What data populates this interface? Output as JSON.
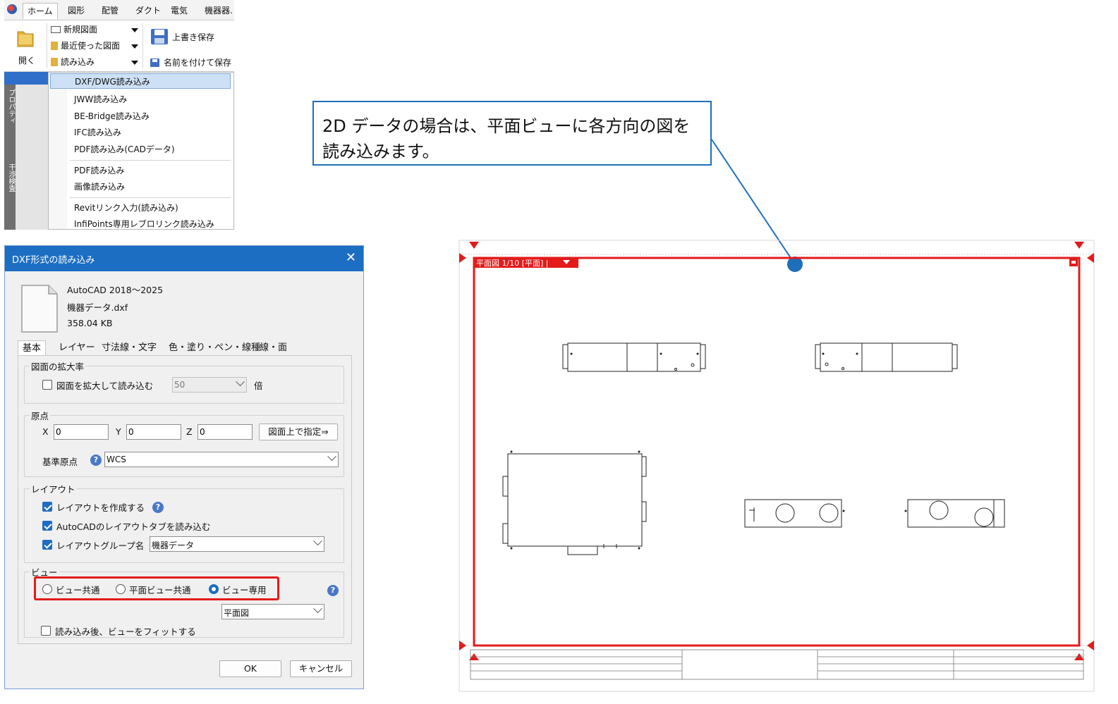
{
  "ribbon": {
    "tabs": [
      "ホーム",
      "図形",
      "配管",
      "ダクト",
      "電気",
      "機器器."
    ],
    "open_label": "開く",
    "menu": {
      "new_drawing": "新規図面",
      "recent": "最近使った図面",
      "import": "読み込み"
    },
    "save": "上書き保存",
    "save_as": "名前を付けて保存",
    "side_tabs": [
      "プロパティ",
      "干渉検査"
    ]
  },
  "dropdown": {
    "items": [
      "DXF/DWG読み込み",
      "JWW読み込み",
      "BE-Bridge読み込み",
      "IFC読み込み",
      "PDF読み込み(CADデータ)",
      "PDF読み込み",
      "画像読み込み",
      "Revitリンク入力(読み込み)",
      "InfiPoints専用レブロリンク読み込み"
    ]
  },
  "dialog": {
    "title": "DXF形式の読み込み",
    "file": {
      "version": "AutoCAD 2018～2025",
      "name": "機器データ.dxf",
      "size": "358.04 KB"
    },
    "tabs": [
      "基本",
      "レイヤー",
      "寸法線・文字",
      "色・塗り・ペン・線種",
      "線・面"
    ],
    "scale_group": {
      "label": "図面の拡大率",
      "checkbox": "図面を拡大して読み込む",
      "checked": false,
      "value": "50",
      "unit": "倍"
    },
    "origin_group": {
      "label": "原点",
      "x_label": "X",
      "x": "0",
      "y_label": "Y",
      "y": "0",
      "z_label": "Z",
      "z": "0",
      "pick_button": "図面上で指定⇒",
      "base_label": "基準原点",
      "base_value": "WCS"
    },
    "layout_group": {
      "label": "レイアウト",
      "create": "レイアウトを作成する",
      "create_checked": true,
      "read_tabs": "AutoCADのレイアウトタブを読み込む",
      "read_tabs_checked": true,
      "group_name_label": "レイアウトグループ名",
      "group_name_checked": true,
      "group_name_value": "機器データ"
    },
    "view_group": {
      "label": "ビュー",
      "options": [
        "ビュー共通",
        "平面ビュー共通",
        "ビュー専用"
      ],
      "selected": "ビュー専用",
      "view_select": "平面図",
      "fit_label": "読み込み後、ビューをフィットする",
      "fit_checked": false
    },
    "ok": "OK",
    "cancel": "キャンセル"
  },
  "callout": {
    "line1": "2D データの場合は、平面ビューに各方向の図を",
    "line2": "読み込みます。",
    "border_color": "#1e6fba"
  },
  "canvas": {
    "view_label": "平面図 1/10 [平面] |",
    "highlight_color": "#e31b1b"
  }
}
